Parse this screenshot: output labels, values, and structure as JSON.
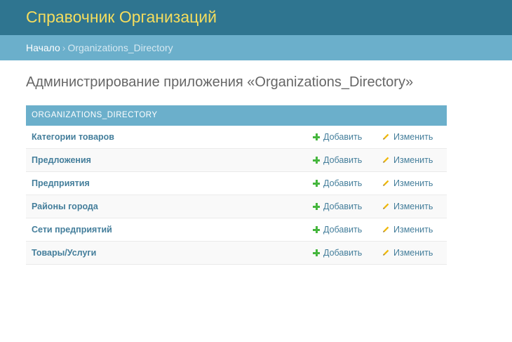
{
  "header": {
    "branding": "Справочник Организаций"
  },
  "breadcrumbs": {
    "home": "Начало",
    "separator": "›",
    "current": "Organizations_Directory"
  },
  "page": {
    "title": "Администрирование приложения «Organizations_Directory»"
  },
  "module": {
    "caption": "ORGANIZATIONS_DIRECTORY",
    "models": [
      {
        "name": "Категории товаров",
        "add": "Добавить",
        "change": "Изменить"
      },
      {
        "name": "Предложения",
        "add": "Добавить",
        "change": "Изменить"
      },
      {
        "name": "Предприятия",
        "add": "Добавить",
        "change": "Изменить"
      },
      {
        "name": "Районы города",
        "add": "Добавить",
        "change": "Изменить"
      },
      {
        "name": "Сети предприятий",
        "add": "Добавить",
        "change": "Изменить"
      },
      {
        "name": "Товары/Услуги",
        "add": "Добавить",
        "change": "Изменить"
      }
    ]
  },
  "colors": {
    "header_bg": "#2f7590",
    "branding_text": "#f5dd5d",
    "breadcrumb_bg": "#6bafcb",
    "link": "#447e9b",
    "add_icon": "#45b63d",
    "change_icon": "#efb80b"
  },
  "icons": {
    "add": "plus-icon",
    "change": "pencil-icon"
  }
}
